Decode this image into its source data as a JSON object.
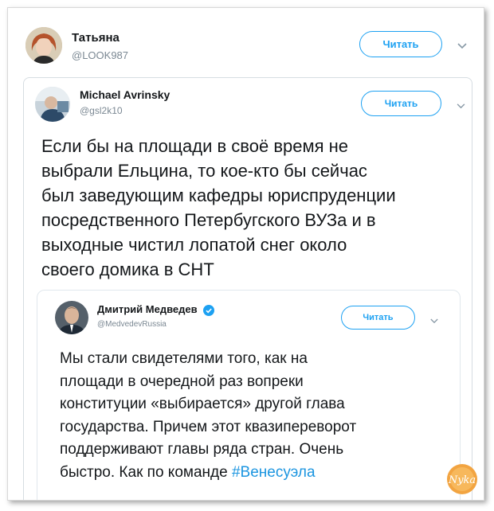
{
  "outer": {
    "name": "Татьяна",
    "handle": "@LOOK987",
    "follow_label": "Читать"
  },
  "quote1": {
    "name": "Michael Avrinsky",
    "handle": "@gsl2k10",
    "follow_label": "Читать",
    "text_lines": [
      "Если бы на площади в своё время не",
      "выбрали Ельцина, то кое-кто бы сейчас",
      "был заведующим кафедры юриспруденции",
      "посредственного Петербугского ВУЗа и в",
      "выходные чистил лопатой снег около",
      "своего домика в СНТ"
    ]
  },
  "quote2": {
    "name": "Дмитрий Медведев",
    "handle": "@MedvedevRussia",
    "follow_label": "Читать",
    "text_lines": [
      "Мы стали свидетелями того, как на",
      "площади в очередной раз вопреки",
      "конституции «выбирается» другой глава",
      "государства. Причем этот квазипереворот",
      "поддерживают главы ряда стран. Очень"
    ],
    "last_line_text": "быстро. Как по команде ",
    "hashtag": "#Венесуэла"
  },
  "watermark": "Nykа",
  "colors": {
    "accent": "#1da1f2",
    "hashtag": "#1b95e0",
    "muted": "#7b8893",
    "logo": "#f2a441"
  }
}
